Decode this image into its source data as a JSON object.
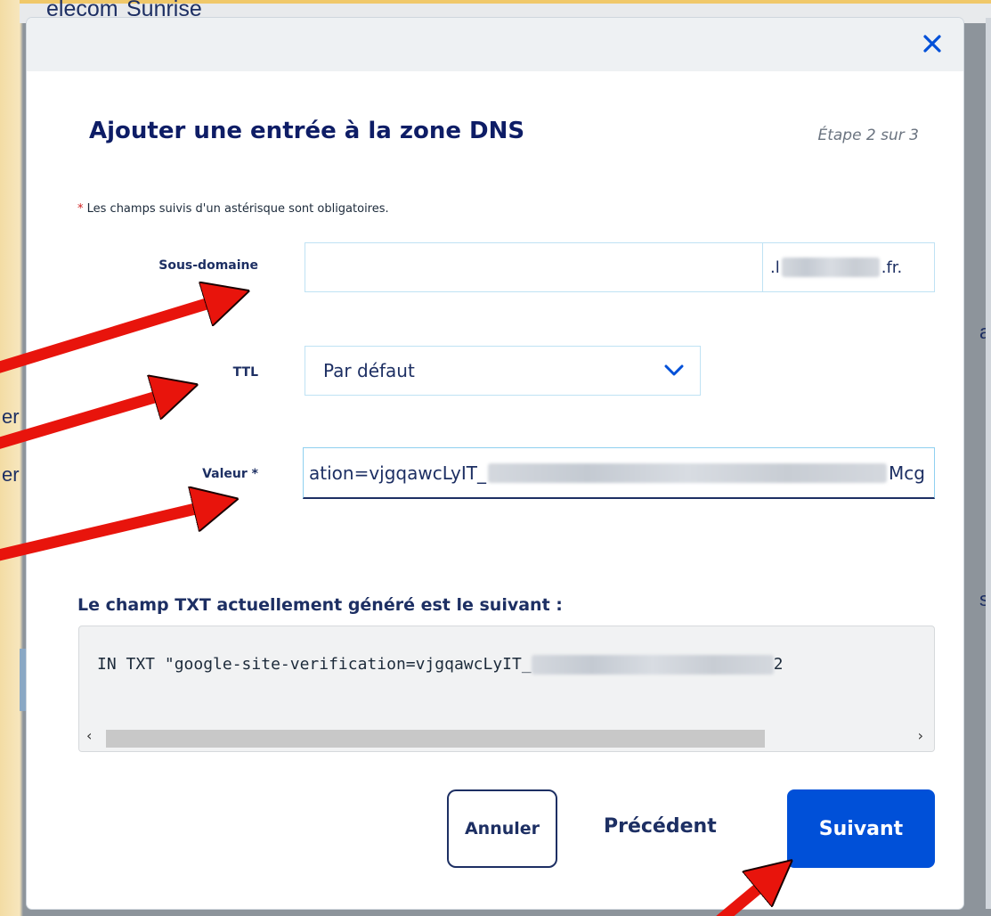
{
  "background": {
    "tabs": [
      "elecom",
      "Sunrise"
    ],
    "side_fragments": [
      "er",
      "er"
    ],
    "right_fragments": [
      "a",
      "s"
    ]
  },
  "modal": {
    "close_icon": "close-icon",
    "title": "Ajouter une entrée à la zone DNS",
    "step": "Étape 2 sur 3",
    "required_note_star": "*",
    "required_note": " Les champs suivis d'un astérisque sont obligatoires.",
    "fields": {
      "subdomain": {
        "label": "Sous-domaine",
        "value": "",
        "suffix_start": ".l",
        "suffix_end": ".fr."
      },
      "ttl": {
        "label": "TTL",
        "selected": "Par défaut",
        "icon": "chevron-down-icon"
      },
      "value": {
        "label": "Valeur *",
        "value_start": "ation=vjgqawcLyIT_",
        "value_end": "Mcg"
      }
    },
    "txt_section": {
      "heading": "Le champ TXT actuellement généré est le suivant :",
      "code_start": "IN TXT \"google-site-verification=vjgqawcLyIT_",
      "code_end": "2",
      "scroll_left": "‹",
      "scroll_right": "›"
    },
    "buttons": {
      "cancel": "Annuler",
      "previous": "Précédent",
      "next": "Suivant"
    }
  },
  "colors": {
    "primary": "#0050d8",
    "navy": "#1d2f63",
    "annotation_arrow": "#e8140c",
    "frame": "#f7e3b4"
  }
}
